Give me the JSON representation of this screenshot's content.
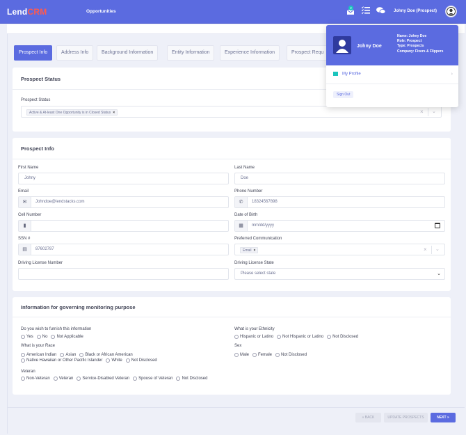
{
  "app": {
    "logo_main": "Lend",
    "logo_accent": "CRM",
    "nav_item": "Opportunities",
    "notification_count": "2",
    "user_label": "Johny Doe (Prospect)"
  },
  "tabs": [
    "Prospect Info",
    "Address Info",
    "Background Information",
    "Entity Information",
    "Experience Information",
    "Prospect Requ"
  ],
  "prospect_status": {
    "title": "Prospect Status",
    "label": "Prospect Status",
    "chip": "Active & At-least One Opportunity is in Closed Status",
    "chip_remove": "×"
  },
  "prospect_info": {
    "title": "Prospect Info",
    "first_name": {
      "label": "First Name",
      "value": "Johny"
    },
    "last_name": {
      "label": "Last Name",
      "value": "Doe"
    },
    "email": {
      "label": "Email",
      "value": "Johndoe@lendstacks.com"
    },
    "phone": {
      "label": "Phone Number",
      "value": "18324567898"
    },
    "cell": {
      "label": "Cell Number",
      "value": ""
    },
    "dob": {
      "label": "Date of Birth",
      "value": "mm/dd/yyyy"
    },
    "ssn": {
      "label": "SSN #",
      "value": "87602787"
    },
    "communication": {
      "label": "Preferred Communication",
      "chip": "Email",
      "chip_remove": "×"
    },
    "license_number": {
      "label": "Driving License Number",
      "value": ""
    },
    "license_state": {
      "label": "Driving License State",
      "value": "Please select state"
    }
  },
  "monitoring": {
    "title": "Information for governing monitoring purpose",
    "furnish": {
      "label": "Do you wish to furnish this information",
      "options": [
        "Yes",
        "No",
        "Not Applicable"
      ]
    },
    "ethnicity": {
      "label": "What is your Ethnicity",
      "options": [
        "Hispanic or Latino",
        "Not Hispanic or Latino",
        "Not Disclosed"
      ]
    },
    "race": {
      "label": "What is your Race",
      "options_line1": [
        "American Indian",
        "Asian",
        "Black or African American"
      ],
      "options_line2": [
        "Native Hawaiian or Other Pacific Islander",
        "White",
        "Not Disclosed"
      ]
    },
    "sex": {
      "label": "Sex",
      "options": [
        "Male",
        "Female",
        "Not Disclosed"
      ]
    },
    "veteran": {
      "label": "Veteran",
      "options": [
        "Non-Veteran",
        "Veteran",
        "Service-Disabled Veteran",
        "Spouse of Veteran",
        "Not Disclosed"
      ]
    }
  },
  "footer": {
    "back": "« BACK",
    "update": "UPDATE PROSPECTS",
    "next": "NEXT »"
  },
  "dropdown": {
    "name": "Johny Doe",
    "info_name": "Name: Johny Doe",
    "info_role": "Role: Prospect",
    "info_type": "Type: Prospects",
    "info_company": "Company: Fixers & Flippers",
    "my_profile": "My Profile",
    "chevron": "›",
    "sign_out": "Sign Out"
  },
  "colors": {
    "primary": "#5b6be0",
    "accent": "#1bc5bd",
    "logo_accent": "#ff5a4e"
  }
}
